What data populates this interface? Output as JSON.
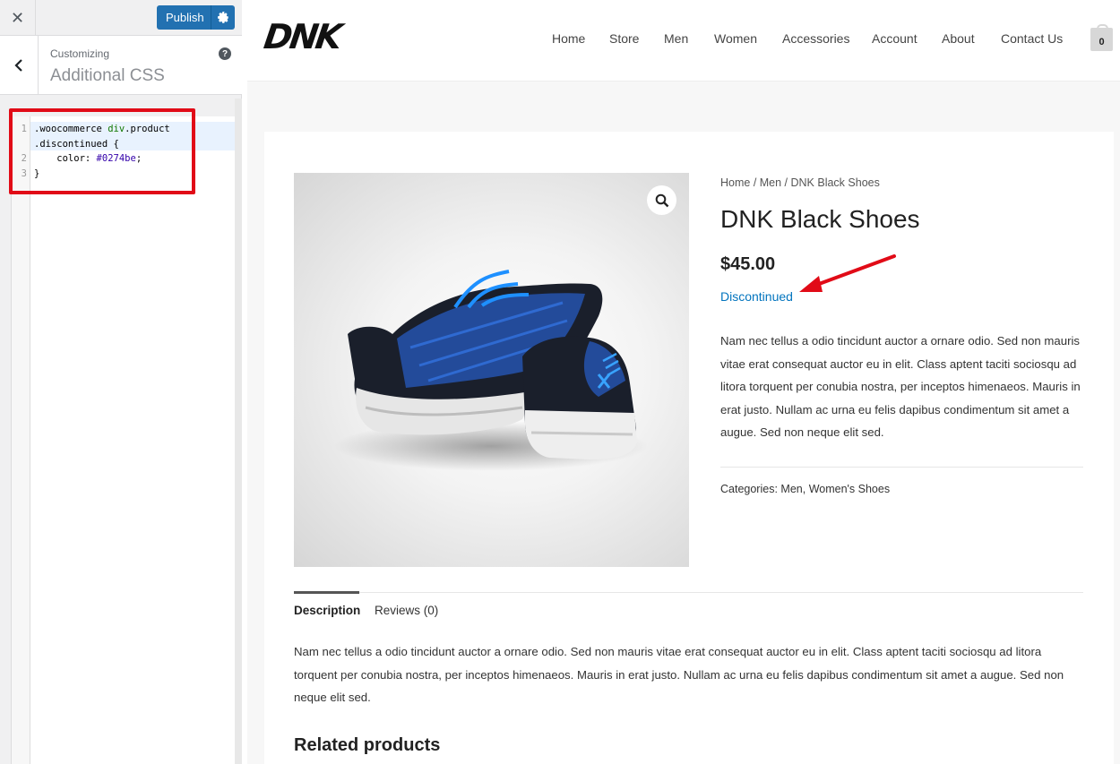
{
  "customizer": {
    "close_icon": "close-icon",
    "publish_label": "Publish",
    "section_sub": "Customizing",
    "section_title": "Additional CSS",
    "help_glyph": "?",
    "code_lines": [
      {
        "num": "1",
        "selector": ".woocommerce ",
        "tag": "div",
        "rest": ".product"
      },
      {
        "num": "",
        "text": ".discontinued {"
      },
      {
        "num": "2",
        "prop": "    color: ",
        "value": "#0274be",
        "end": ";"
      },
      {
        "num": "3",
        "text": "}"
      }
    ],
    "highlight_color": "#e10b17"
  },
  "site": {
    "logo": "DNK",
    "nav": [
      "Home",
      "Store",
      "Men",
      "Women",
      "Accessories",
      "Account",
      "About",
      "Contact Us"
    ],
    "cart_count": "0"
  },
  "product": {
    "breadcrumb": "Home / Men / DNK Black Shoes",
    "title": "DNK Black Shoes",
    "price": "$45.00",
    "status": "Discontinued",
    "status_color": "#0274be",
    "short_description": "Nam nec tellus a odio tincidunt auctor a ornare odio. Sed non mauris vitae erat consequat auctor eu in elit. Class aptent taciti sociosqu ad litora torquent per conubia nostra, per inceptos himenaeos. Mauris in erat justo. Nullam ac urna eu felis dapibus condimentum sit amet a augue. Sed non neque elit sed.",
    "categories_label": "Categories: ",
    "categories": [
      "Men",
      "Women's Shoes"
    ],
    "tabs": [
      "Description",
      "Reviews (0)"
    ],
    "long_description": "Nam nec tellus a odio tincidunt auctor a ornare odio. Sed non mauris vitae erat consequat auctor eu in elit. Class aptent taciti sociosqu ad litora torquent per conubia nostra, per inceptos himenaeos. Mauris in erat justo. Nullam ac urna eu felis dapibus condimentum sit amet a augue. Sed non neque elit sed.",
    "related_heading": "Related products"
  }
}
